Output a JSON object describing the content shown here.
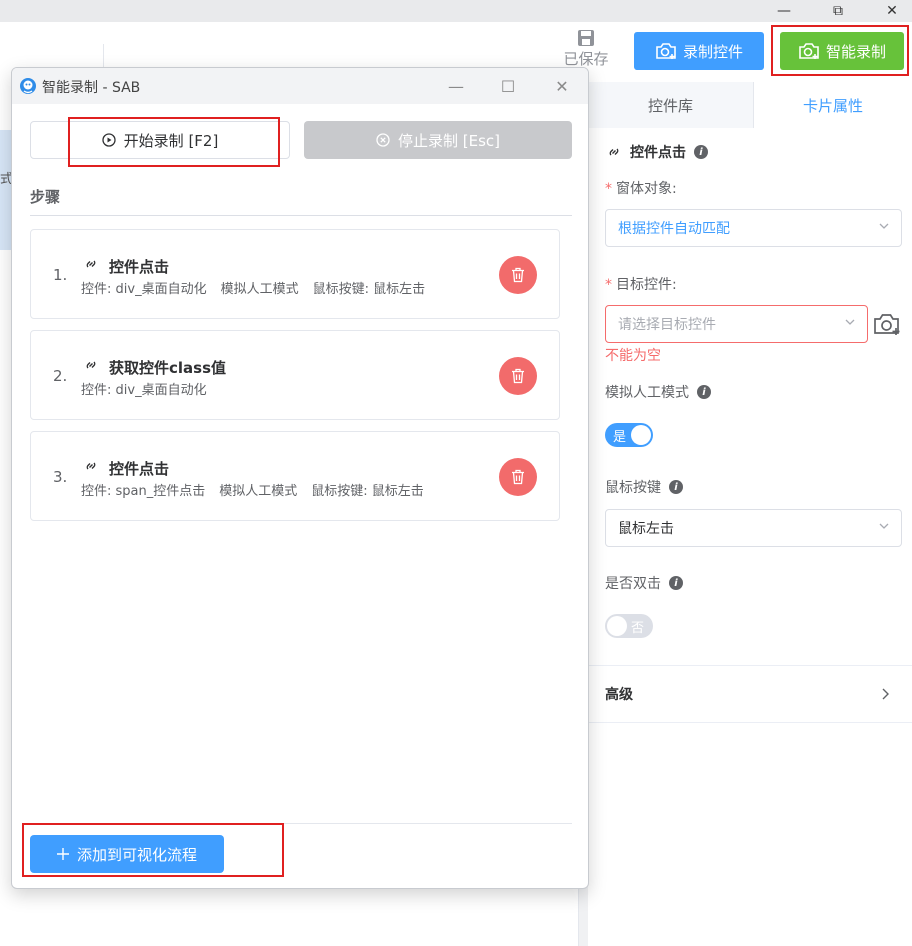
{
  "window": {
    "controls": {
      "minimize": "—",
      "maximize": "⧉",
      "close": "✕"
    }
  },
  "app": {
    "left_edge_text": "式",
    "save_label": "已保存",
    "record_ctrl_label": "录制控件",
    "smart_record_label": "智能录制"
  },
  "right_panel": {
    "tabs": {
      "library": "控件库",
      "card_props": "卡片属性"
    },
    "section_title": "控件点击",
    "window_object": {
      "label": "窗体对象:",
      "value": "根据控件自动匹配"
    },
    "target_ctrl": {
      "label": "目标控件:",
      "placeholder": "请选择目标控件",
      "error": "不能为空"
    },
    "simulate_mode": {
      "label": "模拟人工模式",
      "switch_text": "是"
    },
    "mouse_key": {
      "label": "鼠标按键",
      "value": "鼠标左击"
    },
    "double_click": {
      "label": "是否双击",
      "switch_text": "否"
    },
    "advanced": "高级"
  },
  "dialog": {
    "title": "智能录制 - SAB",
    "start_label": "开始录制 [F2]",
    "stop_label": "停止录制 [Esc]",
    "steps_label": "步骤",
    "steps": [
      {
        "num": "1.",
        "title": "控件点击",
        "desc": [
          "控件: div_桌面自动化",
          "模拟人工模式",
          "鼠标按键: 鼠标左击"
        ]
      },
      {
        "num": "2.",
        "title": "获取控件class值",
        "desc": [
          "控件: div_桌面自动化"
        ]
      },
      {
        "num": "3.",
        "title": "控件点击",
        "desc": [
          "控件: span_控件点击",
          "模拟人工模式",
          "鼠标按键: 鼠标左击"
        ]
      }
    ],
    "add_label": "添加到可视化流程"
  },
  "colors": {
    "primary": "#409eff",
    "success": "#67c23a",
    "danger": "#f56c6c",
    "disabled": "#c8c9cc",
    "highlight_box": "#e02020"
  }
}
